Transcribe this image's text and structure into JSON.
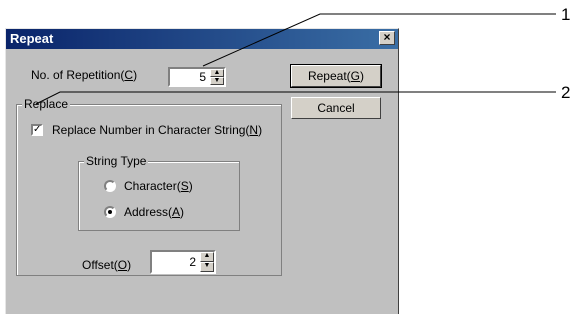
{
  "window": {
    "title": "Repeat",
    "close_label": "×"
  },
  "repetition": {
    "label": "No. of Repetition(",
    "key": "C",
    "suffix": ")",
    "value": "5"
  },
  "buttons": {
    "repeat": {
      "label": "Repeat(",
      "key": "G",
      "suffix": ")"
    },
    "cancel": {
      "label": "Cancel"
    }
  },
  "replace": {
    "group_title": "Replace",
    "checkbox_label": "Replace Number in Character String(",
    "checkbox_key": "N",
    "checkbox_suffix": ")",
    "checked": true
  },
  "string_type": {
    "group_title": "String Type",
    "options": [
      {
        "label": "Character(",
        "key": "S",
        "suffix": ")",
        "checked": false
      },
      {
        "label": "Address(",
        "key": "A",
        "suffix": ")",
        "checked": true
      }
    ]
  },
  "offset": {
    "label": "Offset(",
    "key": "O",
    "suffix": ")",
    "value": "2"
  },
  "callouts": [
    "1",
    "2"
  ]
}
